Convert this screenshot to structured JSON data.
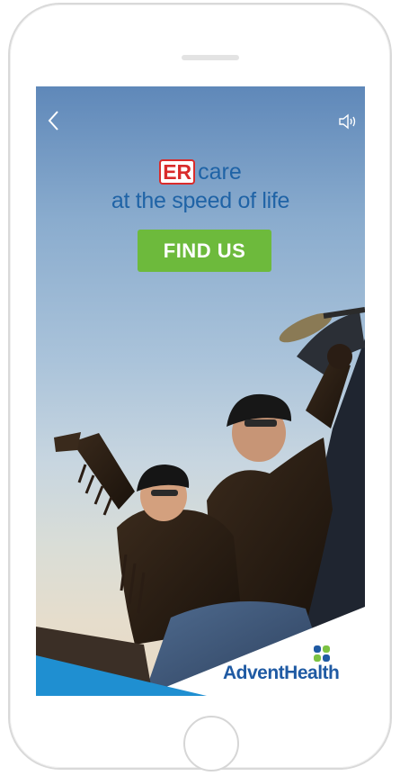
{
  "ad": {
    "badge": "ER",
    "headline_word": "care",
    "tagline": "at the speed of life",
    "cta_label": "FIND US",
    "brand_name": "AdventHealth",
    "back_icon": "chevron-left-icon",
    "sound_icon": "speaker-icon"
  },
  "colors": {
    "headline_blue": "#1f63a6",
    "er_red": "#d92b2b",
    "cta_green": "#6dba3c",
    "brand_blue": "#1f5aa3",
    "corner_blue": "#1f8fd1",
    "logo_green": "#7cc242"
  }
}
